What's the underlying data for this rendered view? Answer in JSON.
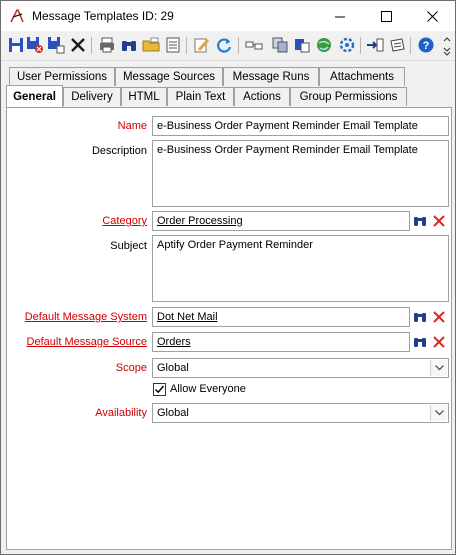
{
  "window": {
    "title": "Message Templates ID: 29",
    "minimize_glyph": "—",
    "maximize_glyph": "☐",
    "close_glyph": "✕"
  },
  "toolbar": {
    "icons": [
      "save-icon",
      "save-close-icon",
      "save-new-icon",
      "delete-icon",
      "print-icon",
      "find-icon",
      "open-folder-icon",
      "list-icon",
      "edit-icon",
      "refresh-icon",
      "link-icon",
      "copy-icon",
      "paste-icon",
      "web-icon",
      "settings-icon",
      "import-icon",
      "export-icon",
      "help-icon",
      "overflow-icon"
    ]
  },
  "tabs": {
    "row_top": [
      "User Permissions",
      "Message Sources",
      "Message Runs",
      "Attachments"
    ],
    "row_bottom": [
      "General",
      "Delivery",
      "HTML",
      "Plain Text",
      "Actions",
      "Group Permissions"
    ],
    "active": "General"
  },
  "form": {
    "name_label": "Name",
    "name_value": "e-Business Order Payment Reminder Email Template",
    "description_label": "Description",
    "description_value": "e-Business Order Payment Reminder Email Template",
    "category_label": "Category",
    "category_value": "Order Processing",
    "subject_label": "Subject",
    "subject_value": "Aptify Order Payment Reminder",
    "default_message_system_label": "Default Message System",
    "default_message_system_value": "Dot Net Mail",
    "default_message_source_label": "Default Message Source",
    "default_message_source_value": "Orders",
    "scope_label": "Scope",
    "scope_value": "Global",
    "allow_everyone_label": "Allow Everyone",
    "allow_everyone_checked": true,
    "availability_label": "Availability",
    "availability_value": "Global"
  },
  "colors": {
    "required_label": "#d10000",
    "lookup_icon": "#1e3f8a",
    "clear_icon": "#d62b1f"
  }
}
